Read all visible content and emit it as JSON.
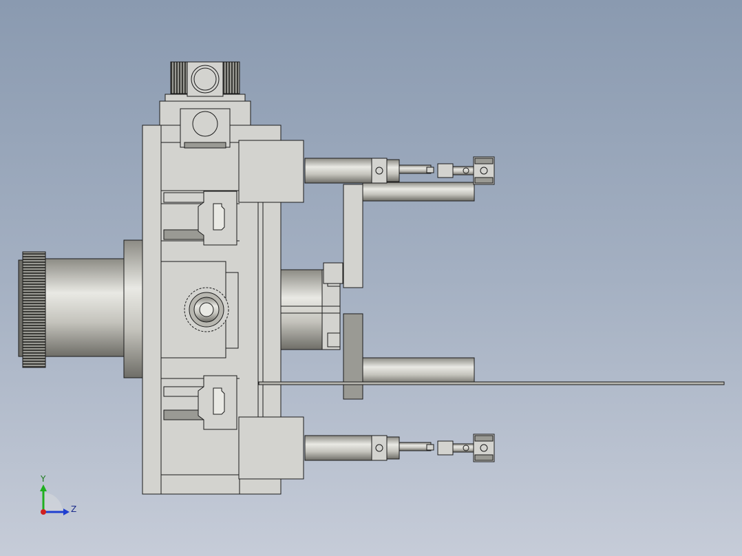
{
  "viewport": {
    "background_top": "#8a9ab0",
    "background_bottom": "#c6ccd8"
  },
  "triad": {
    "y_label": "Y",
    "z_label": "Z",
    "y_color": "#1fb01f",
    "z_color": "#1f3fd0",
    "x_color": "#d02020"
  },
  "model": {
    "part_fill": "#d3d3cf",
    "edge_color": "#1a1a1a",
    "metal_dark": "#8c8b84",
    "metal_light": "#e9e9e4"
  }
}
